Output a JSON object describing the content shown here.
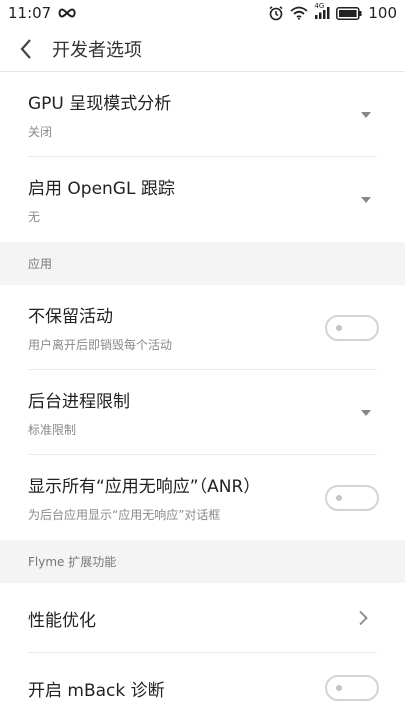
{
  "status_bar": {
    "time": "11:07",
    "infinity_icon": "infinity-icon",
    "alarm_icon": "alarm-icon",
    "wifi_icon": "wifi-icon",
    "network": "4G",
    "signal_icon": "signal-icon",
    "battery_icon": "battery-icon",
    "battery": "100"
  },
  "app_bar": {
    "back_icon": "back-arrow-icon",
    "title": "开发者选项"
  },
  "items_top": [
    {
      "title": "GPU 呈现模式分析",
      "subtitle": "关闭",
      "control": "dropdown"
    },
    {
      "title": "启用 OpenGL 跟踪",
      "subtitle": "无",
      "control": "dropdown"
    }
  ],
  "section_apps": {
    "label": "应用",
    "items": [
      {
        "title": "不保留活动",
        "subtitle": "用户离开后即销毁每个活动",
        "control": "switch",
        "checked": false
      },
      {
        "title": "后台进程限制",
        "subtitle": "标准限制",
        "control": "dropdown"
      },
      {
        "title": "显示所有“应用无响应”（ANR）",
        "subtitle": "为后台应用显示“应用无响应”对话框",
        "control": "switch",
        "checked": false
      }
    ]
  },
  "section_flyme": {
    "label": "Flyme 扩展功能",
    "items": [
      {
        "title": "性能优化",
        "control": "chevron"
      },
      {
        "title": "开启 mBack 诊断",
        "control": "switch",
        "checked": false
      }
    ]
  },
  "colors": {
    "text_primary": "#222222",
    "text_secondary": "#8a8a8a",
    "section_bg": "#f4f4f4",
    "divider": "#e8e8e8"
  }
}
